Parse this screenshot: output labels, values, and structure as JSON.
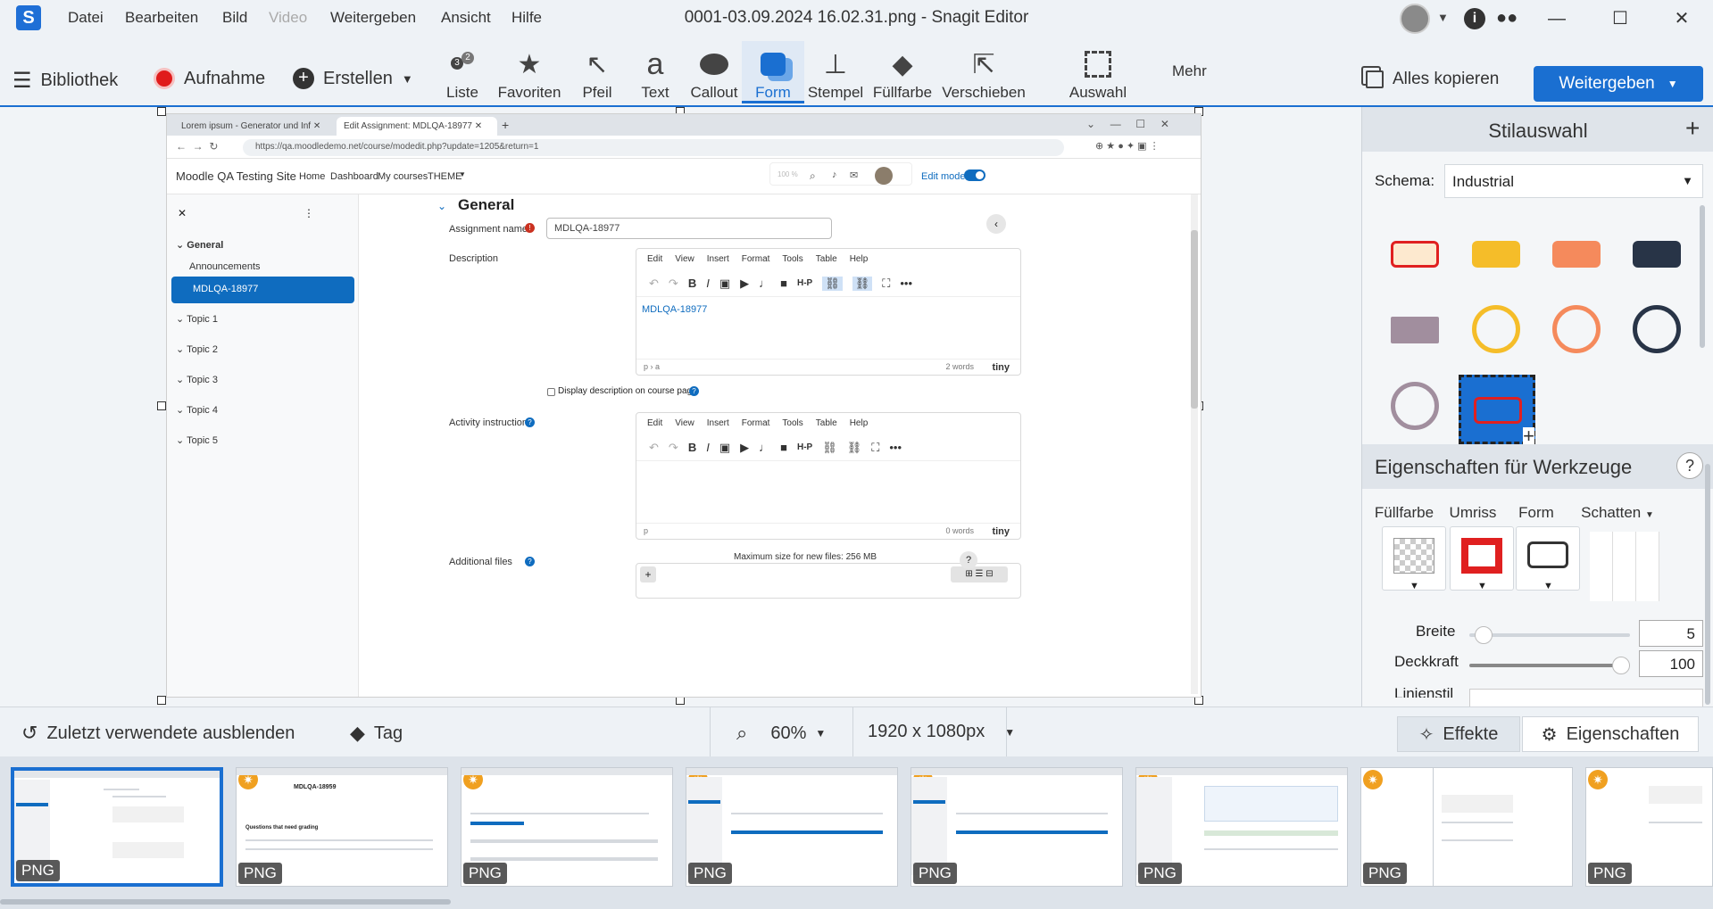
{
  "window": {
    "title": "0001-03.09.2024 16.02.31.png - Snagit Editor",
    "menu": [
      "Datei",
      "Bearbeiten",
      "Bild",
      "Video",
      "Weitergeben",
      "Ansicht",
      "Hilfe"
    ]
  },
  "toolbar": {
    "library": "Bibliothek",
    "capture": "Aufnahme",
    "create": "Erstellen",
    "tools": [
      "Liste",
      "Favoriten",
      "Pfeil",
      "Text",
      "Callout",
      "Form",
      "Stempel",
      "Füllfarbe",
      "Verschieben",
      "Auswahl"
    ],
    "active_tool": "Form",
    "more": "Mehr",
    "copy_all": "Alles kopieren",
    "share": "Weitergeben",
    "list_badges": [
      "3",
      "2"
    ]
  },
  "browser": {
    "tabs": [
      "Lorem ipsum - Generator und Inf",
      "Edit Assignment: MDLQA-18977"
    ],
    "url": "https://qa.moodledemo.net/course/modedit.php?update=1205&return=1",
    "site_name": "Moodle QA Testing Site",
    "nav": [
      "Home",
      "Dashboard",
      "My courses",
      "THEME"
    ],
    "zoom_popup": "100 %",
    "edit_mode": "Edit mode",
    "drawer": {
      "section": "General",
      "items": [
        "Announcements",
        "MDLQA-18977"
      ],
      "topics": [
        "Topic 1",
        "Topic 2",
        "Topic 3",
        "Topic 4",
        "Topic 5"
      ]
    },
    "form": {
      "heading": "General",
      "assignment_label": "Assignment name",
      "assignment_value": "MDLQA-18977",
      "description_label": "Description",
      "editor_menu": [
        "Edit",
        "View",
        "Insert",
        "Format",
        "Tools",
        "Table",
        "Help"
      ],
      "description_text": "MDLQA-18977",
      "desc_path": "p › a",
      "desc_words": "2 words",
      "tiny": "tiny",
      "display_desc": "Display description on course page",
      "activity_label": "Activity instructions",
      "activity_path": "p",
      "activity_words": "0 words",
      "files_label": "Additional files",
      "max_size": "Maximum size for new files: 256 MB"
    }
  },
  "panel": {
    "styles_title": "Stilauswahl",
    "schema_label": "Schema:",
    "schema_value": "Industrial",
    "props_title": "Eigenschaften für Werkzeuge",
    "props": [
      "Füllfarbe",
      "Umriss",
      "Form",
      "Schatten"
    ],
    "width_label": "Breite",
    "width_value": "5",
    "opacity_label": "Deckkraft",
    "opacity_value": "100",
    "line_style_label": "Linienstil",
    "colors": {
      "swatch_cream": "#fde9cf",
      "swatch_red": "#e02020",
      "swatch_yellow": "#f5bd29",
      "swatch_orange": "#f58a5c",
      "swatch_navy": "#283447",
      "swatch_mauve": "#a18e9e"
    }
  },
  "bottom": {
    "hide_recent": "Zuletzt verwendete ausblenden",
    "tag": "Tag",
    "zoom": "60%",
    "size": "1920 x 1080px",
    "effects": "Effekte",
    "properties": "Eigenschaften"
  },
  "tray": {
    "badge": "PNG",
    "thumb_titles": [
      "",
      "MDLQA-18959",
      "",
      "",
      "",
      "",
      "",
      ""
    ],
    "thumb_subtitle": "Questions that need grading"
  }
}
